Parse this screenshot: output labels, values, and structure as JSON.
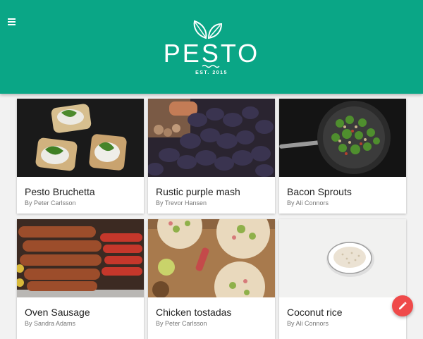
{
  "header": {
    "menu_icon": "menu-icon",
    "logo_icon": "leaf-icon",
    "title": "PESTO",
    "subtitle": "EST. 2015",
    "background": "#0aa686"
  },
  "cards": [
    {
      "title": "Pesto Bruchetta",
      "author": "By Peter Carlsson"
    },
    {
      "title": "Rustic purple mash",
      "author": "By Trevor Hansen"
    },
    {
      "title": "Bacon Sprouts",
      "author": "By Ali Connors"
    },
    {
      "title": "Oven Sausage",
      "author": "By Sandra Adams"
    },
    {
      "title": "Chicken tostadas",
      "author": "By Peter Carlsson"
    },
    {
      "title": "Coconut rice",
      "author": "By Ali Connors"
    }
  ],
  "fab": {
    "icon": "pencil-icon",
    "color": "#ef4a4a"
  }
}
